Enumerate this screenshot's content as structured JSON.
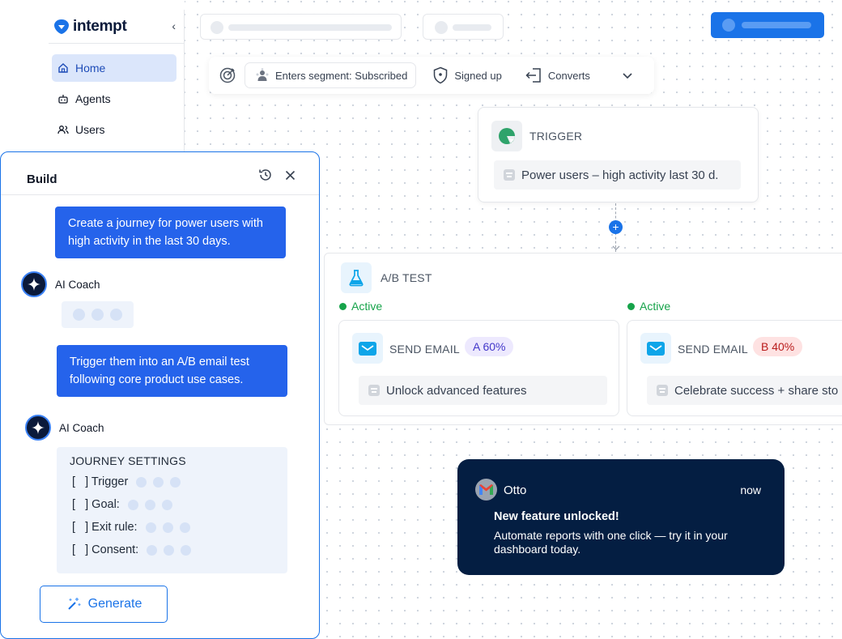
{
  "brand": {
    "name": "intempt"
  },
  "sidebar": {
    "items": [
      {
        "label": "Home",
        "icon": "home-icon",
        "active": true
      },
      {
        "label": "Agents",
        "icon": "robot-icon",
        "active": false
      },
      {
        "label": "Users",
        "icon": "users-icon",
        "active": false
      }
    ]
  },
  "segment_bar": {
    "items": [
      {
        "label": "Enters segment: Subscribed",
        "icon": "segment-icon"
      },
      {
        "label": "Signed up",
        "icon": "shield-icon"
      },
      {
        "label": "Converts",
        "icon": "exit-icon"
      }
    ]
  },
  "trigger": {
    "label": "TRIGGER",
    "condition": "Power users – high activity last 30 d."
  },
  "ab_test": {
    "label": "A/B TEST",
    "branches": [
      {
        "status": "Active",
        "action": "SEND EMAIL",
        "variant": "A 60%",
        "subject": "Unlock advanced features"
      },
      {
        "status": "Active",
        "action": "SEND EMAIL",
        "variant": "B 40%",
        "subject": "Celebrate success + share sto"
      }
    ]
  },
  "notification": {
    "sender": "Otto",
    "time": "now",
    "title": "New feature unlocked!",
    "body": "Automate reports with one click — try it in your dashboard today."
  },
  "build_panel": {
    "title": "Build",
    "messages": [
      {
        "role": "user",
        "text": "Create a journey for power users with high activity in the last 30 days."
      },
      {
        "role": "coach",
        "name": "AI Coach"
      },
      {
        "role": "user",
        "text": "Trigger them into an A/B email test following core product use cases."
      },
      {
        "role": "coach",
        "name": "AI Coach"
      }
    ],
    "settings": {
      "title": "JOURNEY SETTINGS",
      "rows": [
        "[   ] Trigger",
        "[   ] Goal:",
        "[   ] Exit rule:",
        "[   ] Consent:"
      ]
    },
    "generate_label": "Generate"
  },
  "colors": {
    "primary": "#1a73e8",
    "active_green": "#16a34a",
    "navy": "#041e42",
    "variant_a_bg": "#ede9fe",
    "variant_b_bg": "#fee2e2"
  }
}
